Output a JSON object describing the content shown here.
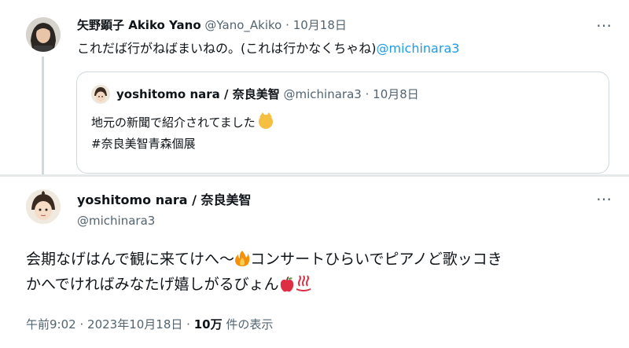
{
  "reply_tweet": {
    "author_name": "矢野顕子 Akiko Yano",
    "handle": "@Yano_Akiko",
    "separator": "·",
    "date": "10月18日",
    "text": "これだば行がねばまいねの。(これは行かなくちゃね)",
    "mention": "@michinara3",
    "more_icon": "ellipsis-icon"
  },
  "quoted_tweet": {
    "author_name": "yoshitomo nara / 奈良美智",
    "handle": "@michinara3",
    "separator": "·",
    "date": "10月8日",
    "line1": "地元の新聞で紹介されてました",
    "emoji1": "smiling-cat-emoji",
    "hashtag": "#奈良美智青森個展"
  },
  "main_tweet": {
    "author_name": "yoshitomo nara / 奈良美智",
    "handle": "@michinara3",
    "more_icon": "ellipsis-icon",
    "text_line1": "会期なげはんで観に来てけへ〜",
    "text_line1_b": "コンサートひらいでピアノど歌ッコき",
    "text_line2": "かへでければみなたげ嬉しがるびょん",
    "time": "午前9:02",
    "separator": "·",
    "date": "2023年10月18日",
    "views_count": "10万",
    "views_label": "件の表示"
  },
  "colors": {
    "text": "#0f1419",
    "muted": "#536471",
    "link": "#1d9bf0",
    "border": "#cfd9de"
  }
}
